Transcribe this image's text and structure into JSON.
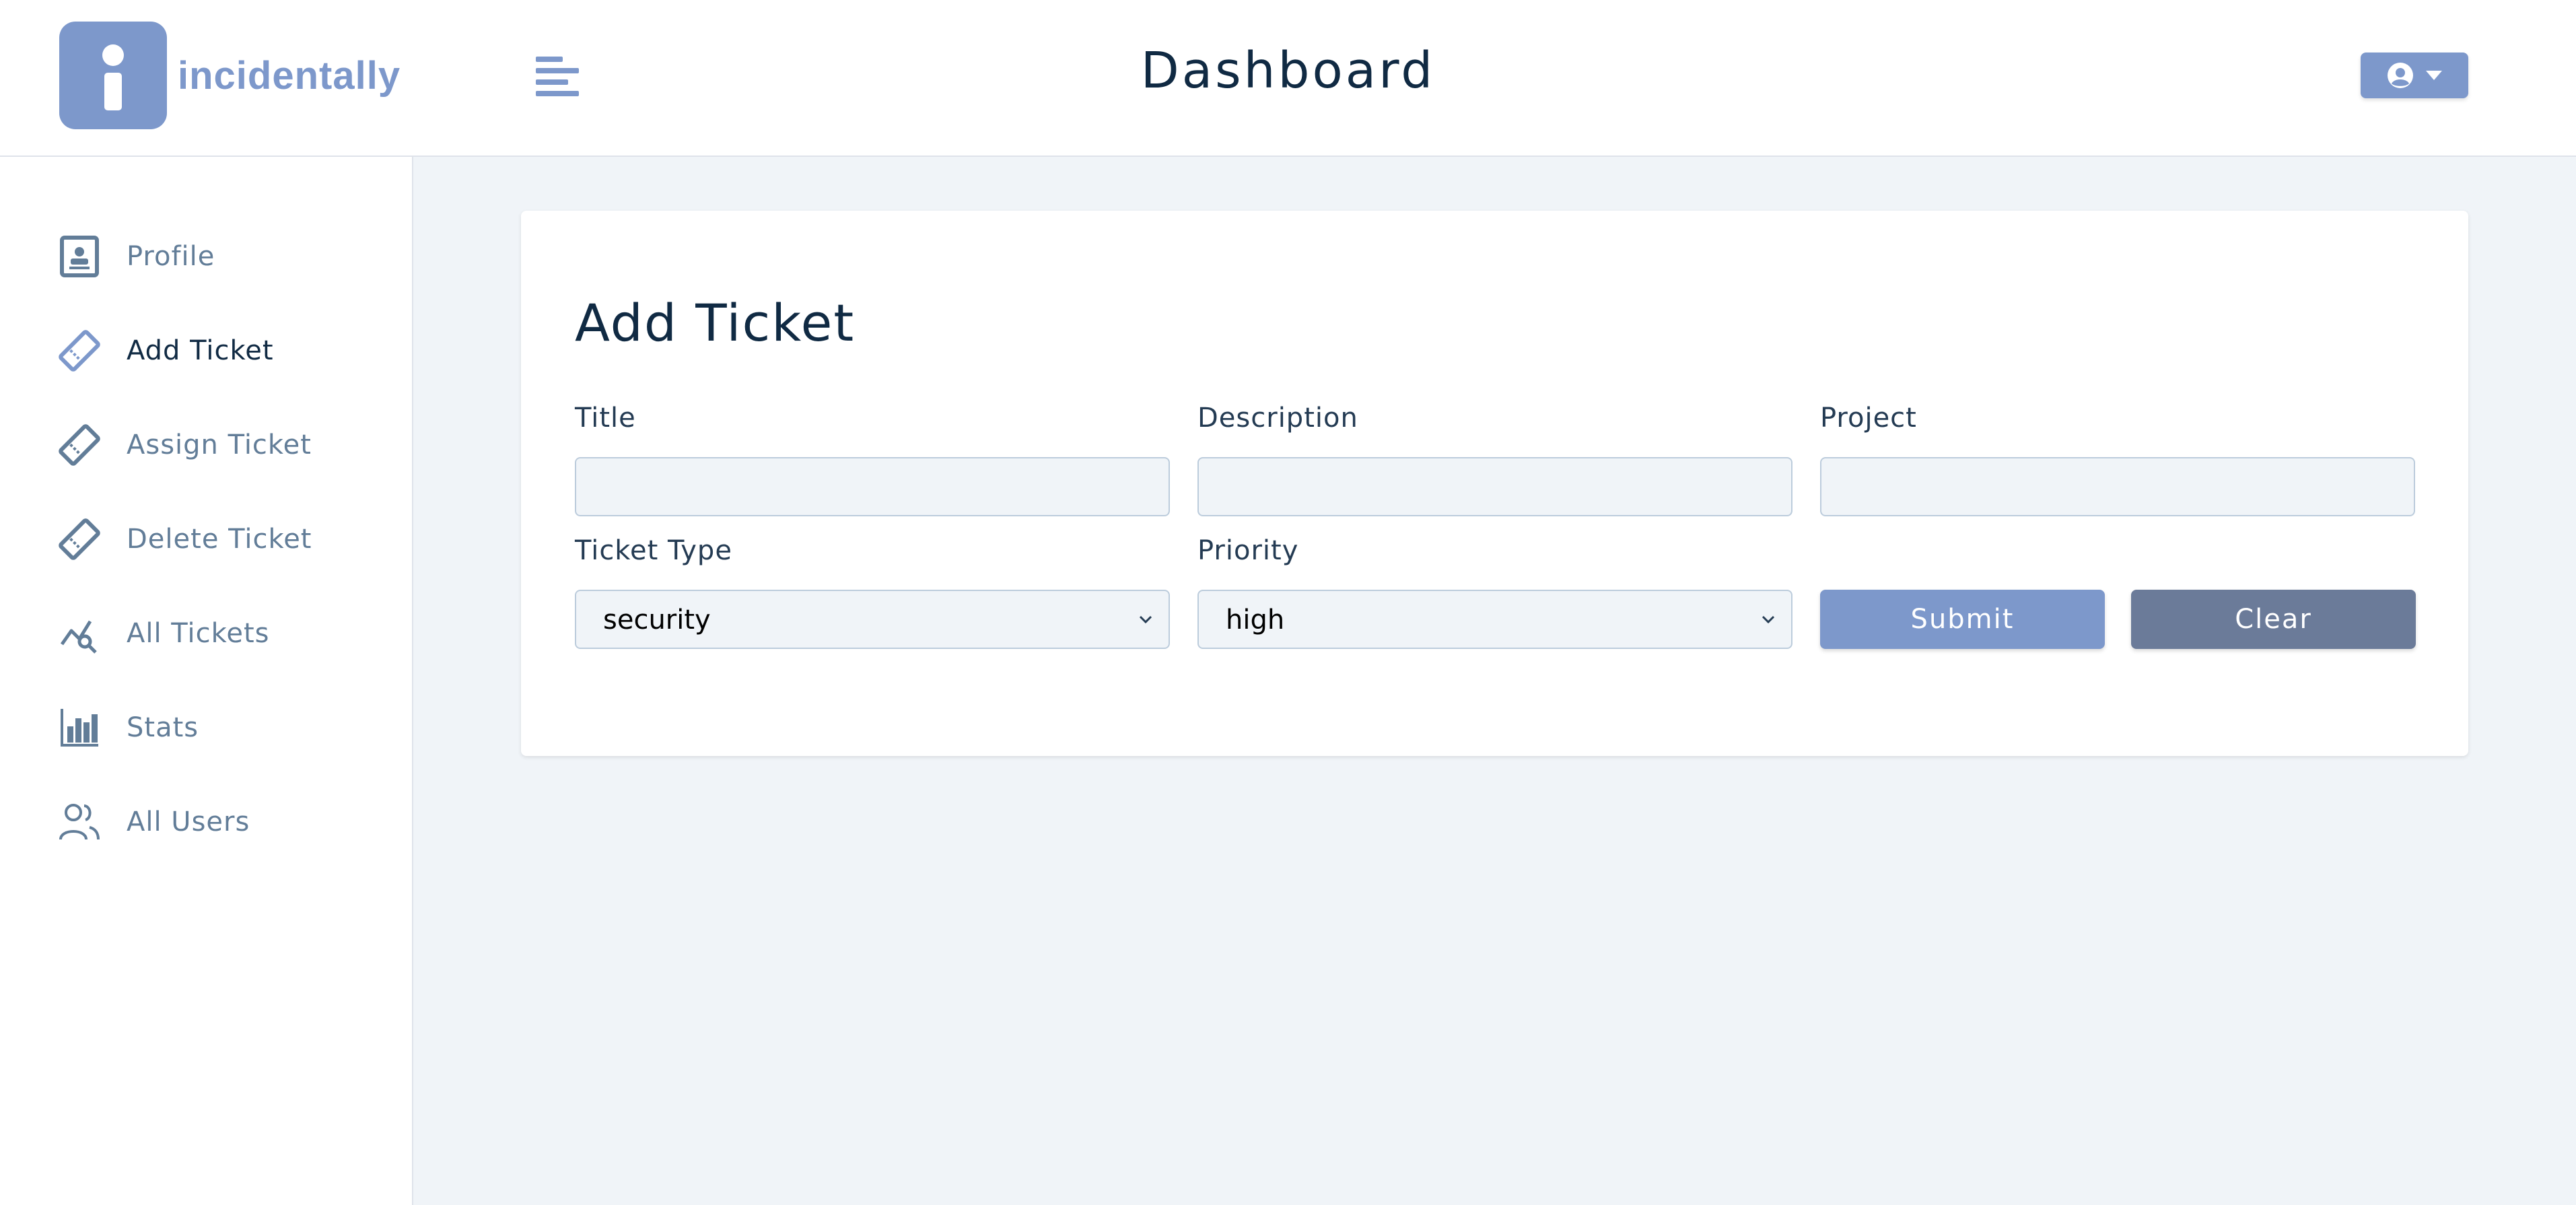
{
  "app": {
    "name": "incidentally",
    "page_title": "Dashboard"
  },
  "colors": {
    "accent": "#7d98cb",
    "clear_button": "#6b7b99",
    "background": "#f0f4f8",
    "text_dark": "#102a43",
    "text_muted": "#627d98"
  },
  "header": {
    "toggle_icon": "menu-toggle-icon",
    "user_menu_icons": [
      "user-circle-icon",
      "caret-down-icon"
    ]
  },
  "sidebar": {
    "items": [
      {
        "label": "Profile",
        "icon": "profile-icon",
        "active": false
      },
      {
        "label": "Add Ticket",
        "icon": "ticket-icon",
        "active": true
      },
      {
        "label": "Assign Ticket",
        "icon": "ticket-icon",
        "active": false
      },
      {
        "label": "Delete Ticket",
        "icon": "ticket-icon",
        "active": false
      },
      {
        "label": "All Tickets",
        "icon": "chart-search-icon",
        "active": false
      },
      {
        "label": "Stats",
        "icon": "bar-chart-icon",
        "active": false
      },
      {
        "label": "All Users",
        "icon": "users-icon",
        "active": false
      }
    ]
  },
  "form": {
    "title": "Add Ticket",
    "fields": {
      "title": {
        "label": "Title",
        "value": ""
      },
      "description": {
        "label": "Description",
        "value": ""
      },
      "project": {
        "label": "Project",
        "value": ""
      },
      "ticket_type": {
        "label": "Ticket Type",
        "selected": "security"
      },
      "priority": {
        "label": "Priority",
        "selected": "high"
      }
    },
    "submit_label": "Submit",
    "clear_label": "Clear"
  }
}
